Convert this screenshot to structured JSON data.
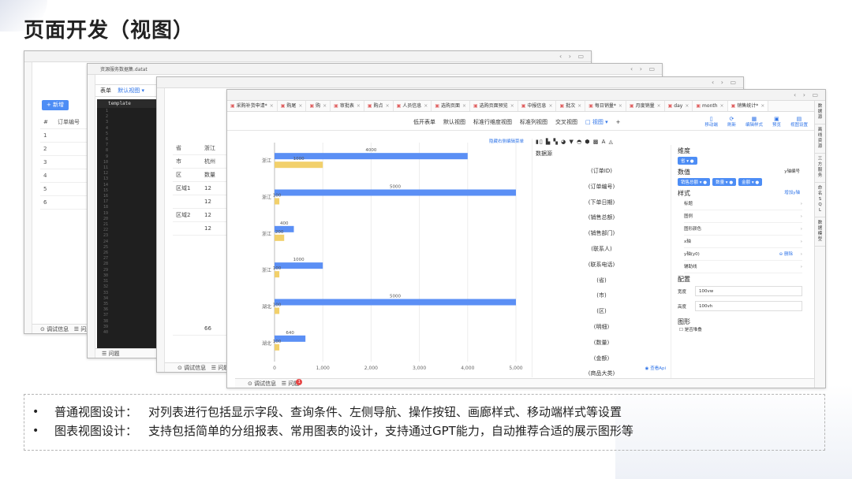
{
  "slide": {
    "title": "页面开发（视图）"
  },
  "window_controls": "‹ › ▭",
  "w1": {
    "add_button": "+ 新增",
    "col_header": "订单编号",
    "rows": [
      "1",
      "2",
      "3",
      "4",
      "5",
      "6"
    ],
    "bottom": [
      "调试信息",
      "问题"
    ]
  },
  "w2": {
    "title_tab": "资源服务数据集.datat",
    "subbar_left": "表单",
    "subbar_view": "默认视图 ▾",
    "template_label": "template",
    "line_numbers": "1\n2\n3\n4\n5\n6\n7\n8\n9\n10\n11\n12\n13\n14\n15\n16\n17\n18\n19\n20\n21\n22\n23\n24\n25\n26\n27\n28\n29\n30\n31\n32\n33\n34\n35\n36\n37\n38\n39\n40",
    "bottom": "问题"
  },
  "w3": {
    "rows": [
      [
        "省",
        "浙江"
      ],
      [
        "市",
        "杭州"
      ],
      [
        "区",
        "数量"
      ],
      [
        "区域1",
        "12"
      ],
      [
        "",
        "12"
      ],
      [
        "区域2",
        "12"
      ],
      [
        "",
        "12"
      ]
    ],
    "footer_value": "66",
    "bottom": [
      "调试信息",
      "问题"
    ]
  },
  "w4": {
    "tabs": [
      "采购补货申请*",
      "购尾",
      "购",
      "审批表",
      "购点",
      "人员信息",
      "选购页面",
      "选购页面预览",
      "中报信息",
      "批次",
      "每日销量*",
      "月度销量",
      "day",
      "month",
      "销售统计*"
    ],
    "right_rail": [
      "数据源",
      "离线资源",
      "三方服务",
      "命名SQL",
      "数据模型"
    ],
    "views": [
      "低开表单",
      "默认视图",
      "标准行维度视图",
      "标准列视图",
      "交叉视图",
      "□ 视图 ▾",
      "+"
    ],
    "tools": [
      {
        "icon": "▯",
        "label": "移动端"
      },
      {
        "icon": "⟳",
        "label": "刷新"
      },
      {
        "icon": "▦",
        "label": "编辑样式"
      },
      {
        "icon": "▣",
        "label": "预览"
      },
      {
        "icon": "▤",
        "label": "视图设置"
      }
    ],
    "chart_hint": "隐藏右侧编辑菜单",
    "field_icons": "▮▯ ▙ ▚ ◕ ▼ ◓ ⬢ ▩ A ◬",
    "field_title": "数据源",
    "fields": [
      "(订单ID)",
      "(订单编号)",
      "(下单日期)",
      "(销售总额)",
      "(销售部门)",
      "(联系人)",
      "(联系电话)",
      "(省)",
      "(市)",
      "(区)",
      "(明细)",
      "(数量)",
      "(金额)",
      "(商品大类)"
    ],
    "field_api": "查看Api",
    "props": {
      "dim_title": "维度",
      "dim_chip": "省 ▾ ●",
      "val_title": "数值",
      "y_axis_label": "y轴编号",
      "val_chips": [
        "销售总额 ▾ ●",
        "数量 ▾ ●",
        "金额 ▾ ●"
      ],
      "style_title": "样式",
      "add_y": "增加y轴",
      "style_items": [
        "标题",
        "图例",
        "图形颜色",
        "x轴",
        "y轴(y0)",
        "辅助线"
      ],
      "delete_label": "删除",
      "config_title": "配置",
      "width_label": "宽度",
      "width_value": "100vw",
      "height_label": "高度",
      "height_value": "100vh",
      "shape_title": "图形",
      "stack_label": "是否堆叠"
    },
    "bottom": [
      "调试信息",
      "问题"
    ],
    "badge": "1"
  },
  "chart_data": {
    "type": "bar",
    "orientation": "horizontal",
    "categories": [
      "浙江",
      "浙江",
      "浙江",
      "浙江",
      "湖北",
      "湖北"
    ],
    "series": [
      {
        "color": "#5b8ff5",
        "values": [
          4000,
          5000,
          400,
          1000,
          5000,
          640
        ]
      },
      {
        "color": "#f2d06b",
        "values": [
          1000,
          100,
          200,
          100,
          100,
          100
        ]
      }
    ],
    "bar_labels": [
      "4000",
      "1000",
      "5000",
      "100",
      "400",
      "200",
      "1000",
      "100",
      "5000",
      "100",
      "640",
      "100"
    ],
    "xticks": [
      "0",
      "1,000",
      "2,000",
      "3,000",
      "4,000",
      "5,000"
    ],
    "xlim": [
      0,
      5000
    ]
  },
  "bullets": [
    {
      "label": "普通视图设计：",
      "text": "对列表进行包括显示字段、查询条件、左侧导航、操作按钮、画廊样式、移动端样式等设置"
    },
    {
      "label": "图表视图设计：",
      "text": "支持包括简单的分组报表、常用图表的设计，支持通过GPT能力，自动推荐合适的展示图形等"
    }
  ]
}
